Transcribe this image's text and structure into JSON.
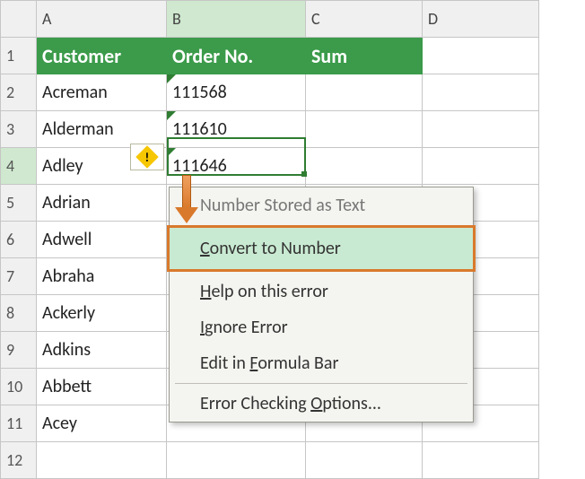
{
  "columns": {
    "rownum": "",
    "A": "A",
    "B": "B",
    "C": "C",
    "D": "D"
  },
  "headers": {
    "A": "Customer",
    "B": "Order No.",
    "C": "Sum"
  },
  "rows": [
    {
      "n": "1"
    },
    {
      "n": "2",
      "A": "Acreman",
      "B": "111568"
    },
    {
      "n": "3",
      "A": "Alderman",
      "B": "111610"
    },
    {
      "n": "4",
      "A": "Adley",
      "B": "111646"
    },
    {
      "n": "5",
      "A": "Adrian"
    },
    {
      "n": "6",
      "A": "Adwell"
    },
    {
      "n": "7",
      "A": "Abraha"
    },
    {
      "n": "8",
      "A": "Ackerly"
    },
    {
      "n": "9",
      "A": "Adkins"
    },
    {
      "n": "10",
      "A": "Abbett"
    },
    {
      "n": "11",
      "A": "Acey"
    },
    {
      "n": "12"
    }
  ],
  "menu": {
    "title": "Number Stored as Text",
    "convert_pre": "C",
    "convert_rest": "onvert to Number",
    "help_pre": "H",
    "help_rest": "elp on this error",
    "ignore_pre": "I",
    "ignore_rest": "gnore Error",
    "edit_pre": "Edit in ",
    "edit_mn": "F",
    "edit_post": "ormula Bar",
    "opts_pre": "Error Checking ",
    "opts_mn": "O",
    "opts_post": "ptions..."
  }
}
